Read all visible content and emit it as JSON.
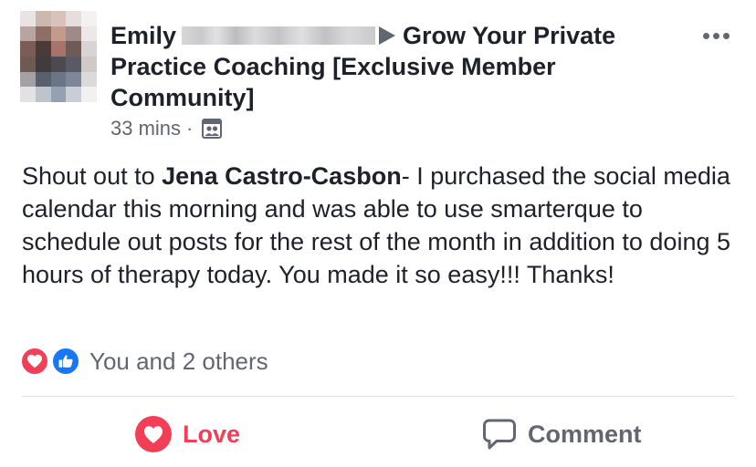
{
  "post": {
    "author": "Emily",
    "group_name": "Grow Your Private Practice Coaching [Exclusive Member Community]",
    "time": "33 mins",
    "separator": "·",
    "body": {
      "part1": "Shout out to ",
      "mention": "Jena Castro-Casbon",
      "part2": "-  I purchased the social media calendar this morning and was able to use smarterque to schedule out posts for the rest of the month in addition to doing 5 hours of therapy today.  You made it so easy!!! Thanks!"
    },
    "reactions": {
      "text": "You and 2 others",
      "types": [
        "love",
        "like"
      ]
    },
    "actions": {
      "love_label": "Love",
      "comment_label": "Comment"
    }
  },
  "icons": {
    "more": "more-options-icon",
    "audience": "group-audience-icon",
    "love": "heart-icon",
    "like": "thumbs-up-icon",
    "comment": "comment-bubble-icon"
  },
  "colors": {
    "love": "#f33e58",
    "like": "#1877f2",
    "secondary_text": "#606770",
    "primary_text": "#1d2129"
  }
}
